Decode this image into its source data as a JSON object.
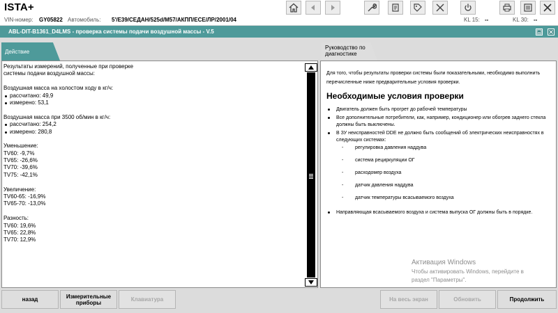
{
  "app": {
    "title": "ISTA+"
  },
  "toolbar": {
    "icons": [
      "home-icon",
      "back-icon",
      "forward-icon",
      "wrench-icon",
      "document-icon",
      "tag-icon",
      "tools-icon",
      "power-icon",
      "print-icon",
      "checklist-icon",
      "close-icon"
    ]
  },
  "vehicle": {
    "vin_label": "VIN-номер:",
    "vin_value": "GY05822",
    "car_label": "Автомобиль:",
    "car_value": "5'/E39/СЕДАН/525d/M57/АКПП/ECE/ЛР/2001/04",
    "kl15_label": "KL 15:",
    "kl15_value": "--",
    "kl30_label": "KL 30:",
    "kl30_value": "--"
  },
  "module": {
    "title": "ABL-DIT-B1361_D4LMS  -  проверка системы подачи воздушной массы  -  V.5"
  },
  "tabs": {
    "action": "Действие",
    "guide": "Руководство по диагностике"
  },
  "results": {
    "lines": [
      "Результаты измерений, полученные при проверке",
      "системы подачи воздушной массы:",
      "",
      "Воздушная масса на холостом ходу в кг/ч:",
      "рассчитано: 49,9",
      "измерено: 53,1",
      "",
      "Воздушная масса при 3500 об/мин в кг/ч:",
      "рассчитано: 254,2",
      "измерено: 280,8",
      "",
      "Уменьшение:",
      "TV60: -9,7%",
      "TV65: -26,6%",
      "TV70: -39,6%",
      "TV75: -42,1%",
      "",
      "Увеличение:",
      "TV60-65: -16,9%",
      "TV65-70: -13,0%",
      "",
      "Разность:",
      "TV60: 19,6%",
      "TV65: 22,8%",
      "TV70: 12,9%"
    ]
  },
  "guide": {
    "intro": "Для того, чтобы результаты проверки системы были показательными, необходимо выполнить перечисленные ниже предварительные условия проверки.",
    "heading": "Необходимые условия проверки",
    "bullet1": "Двигатель должен быть прогрет до рабочей температуры",
    "bullet2": "Все дополнительные потребители, как, например, кондиционер или обогрев заднего стекла должны быть выключены.",
    "bullet3": "В ЗУ неисправностей DDE не должно быть сообщений об электрических неисправностях в следующих системах:",
    "sub": [
      "регулировка давления наддува",
      "система рециркуляции ОГ",
      "расходомер воздуха",
      "датчик давления наддува",
      "датчик температуры всасываемого воздуха"
    ],
    "dash": "-",
    "bullet4": "Направляющая всасываемого воздуха и система выпуска ОГ должны быть в порядке."
  },
  "watermark": {
    "line1": "Активация Windows",
    "line2": "Чтобы активировать Windows, перейдите в",
    "line3": "раздел \"Параметры\"."
  },
  "buttons": {
    "back": "назад",
    "measuring": "Измерительные приборы",
    "keyboard": "Клавиатура",
    "fullscreen": "На весь экран",
    "refresh": "Обновить",
    "continue": "Продолжить"
  }
}
